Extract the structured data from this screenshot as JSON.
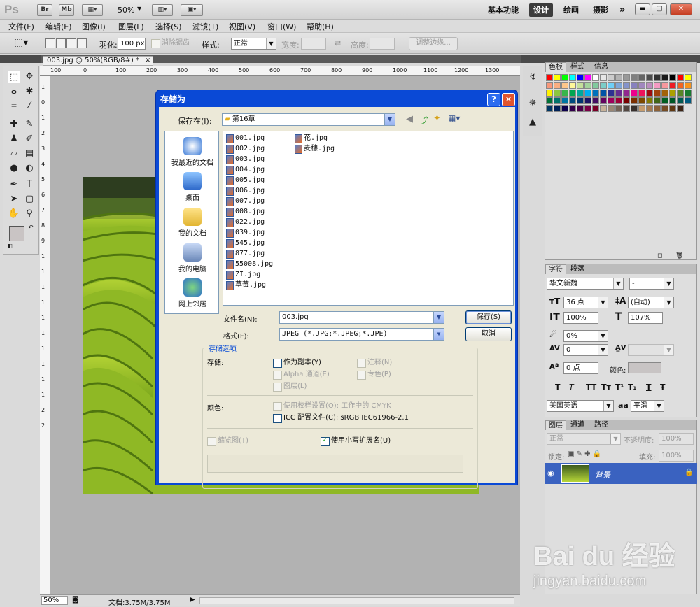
{
  "app": {
    "logo": "Ps",
    "bridge_btn": "Br",
    "minibridge_btn": "Mb",
    "zoom": "50%",
    "workspaces": [
      "基本功能",
      "设计",
      "绘画",
      "摄影"
    ],
    "active_workspace": "设计",
    "more": "»"
  },
  "menu": [
    "文件(F)",
    "编辑(E)",
    "图像(I)",
    "图层(L)",
    "选择(S)",
    "滤镜(T)",
    "视图(V)",
    "窗口(W)",
    "帮助(H)"
  ],
  "options": {
    "feather_label": "羽化:",
    "feather_value": "100 px",
    "antialias_label": "消除锯齿",
    "style_label": "样式:",
    "style_value": "正常",
    "width_label": "宽度:",
    "height_label": "高度:",
    "refine_btn": "调整边缘..."
  },
  "document": {
    "tab": "003.jpg @ 50%(RGB/8#) *",
    "ruler_h": [
      "100",
      "0",
      "100",
      "200",
      "300",
      "400",
      "500",
      "600",
      "700",
      "800",
      "900",
      "1000",
      "1100",
      "1200",
      "1300"
    ],
    "ruler_v": [
      "1",
      "0",
      "1",
      "2",
      "3",
      "4",
      "5",
      "6",
      "7",
      "8",
      "9",
      "1",
      "1",
      "1",
      "1",
      "1",
      "1",
      "1",
      "1",
      "1",
      "1",
      "2",
      "2"
    ],
    "status_zoom": "50%",
    "status_doc": "文档:3.75M/3.75M"
  },
  "swatches_panel": {
    "tabs": [
      "色板",
      "样式",
      "信息"
    ],
    "active": "色板"
  },
  "char_panel": {
    "tabs": [
      "字符",
      "段落"
    ],
    "font_family": "华文新魏",
    "font_style": "-",
    "size": "36 点",
    "leading": "(自动)",
    "vscale": "100%",
    "hscale": "107%",
    "tracking_shift": "0%",
    "kerning": "0",
    "baseline": "0 点",
    "color_label": "颜色:",
    "style_buttons": [
      "T",
      "T",
      "TT",
      "Tт",
      "T¹",
      "T₁",
      "T",
      "Ŧ"
    ],
    "language": "美国英语",
    "aa_label": "aa",
    "aa_value": "平滑"
  },
  "layers_panel": {
    "tabs": [
      "图层",
      "通道",
      "路径"
    ],
    "blend": "正常",
    "opacity_label": "不透明度:",
    "opacity": "100%",
    "lock_label": "锁定:",
    "fill_label": "填充:",
    "fill": "100%",
    "layer_name": "背景"
  },
  "dialog": {
    "title": "存储为",
    "help_btn": "?",
    "close_btn": "✕",
    "save_in_label": "保存在(I):",
    "save_in_value": "第16章",
    "places": [
      "我最近的文档",
      "桌面",
      "我的文档",
      "我的电脑",
      "网上邻居"
    ],
    "files_col1": [
      "001.jpg",
      "002.jpg",
      "003.jpg",
      "004.jpg",
      "005.jpg",
      "006.jpg",
      "007.jpg",
      "008.jpg",
      "022.jpg",
      "039.jpg",
      "545.jpg",
      "877.jpg",
      "55008.jpg",
      "ZI.jpg",
      "草莓.jpg"
    ],
    "files_col2": [
      "花.jpg",
      "麦穗.jpg"
    ],
    "filename_label": "文件名(N):",
    "filename_value": "003.jpg",
    "format_label": "格式(F):",
    "format_value": "JPEG (*.JPG;*.JPEG;*.JPE)",
    "save_btn": "保存(S)",
    "cancel_btn": "取消",
    "options_title": "存储选项",
    "store_label": "存储:",
    "as_copy": "作为副本(Y)",
    "annotations": "注释(N)",
    "alpha": "Alpha 通道(E)",
    "spot": "专色(P)",
    "layers": "图层(L)",
    "color_label": "颜色:",
    "proof": "使用校样设置(O): 工作中的 CMYK",
    "icc": "ICC 配置文件(C): sRGB IEC61966-2.1",
    "thumbnail": "缩览图(T)",
    "lowercase": "使用小写扩展名(U)"
  },
  "watermark": {
    "brand": "Bai du 经验",
    "url": "jingyan.baidu.com"
  }
}
